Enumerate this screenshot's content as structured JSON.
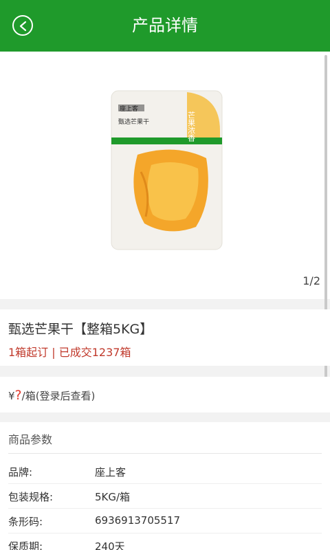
{
  "header": {
    "title": "产品详情"
  },
  "gallery": {
    "indicator": "1/2",
    "brand_print": "座上客",
    "product_print": "甄选芒果干",
    "slogan": "芒果浓香"
  },
  "product": {
    "name": "甄选芒果干【整箱5KG】",
    "order_info": "1箱起订 | 已成交1237箱"
  },
  "price": {
    "symbol": "¥",
    "value": "?",
    "unit": "/箱(登录后查看)"
  },
  "params": {
    "title": "商品参数",
    "rows": [
      {
        "label": "品牌:",
        "value": "座上客"
      },
      {
        "label": "包装规格:",
        "value": "5KG/箱"
      },
      {
        "label": "条形码:",
        "value": "6936913705517"
      },
      {
        "label": "保质期:",
        "value": "240天"
      }
    ]
  },
  "colors": {
    "header": "#1f9a2b",
    "accent_red": "#c0392b"
  }
}
